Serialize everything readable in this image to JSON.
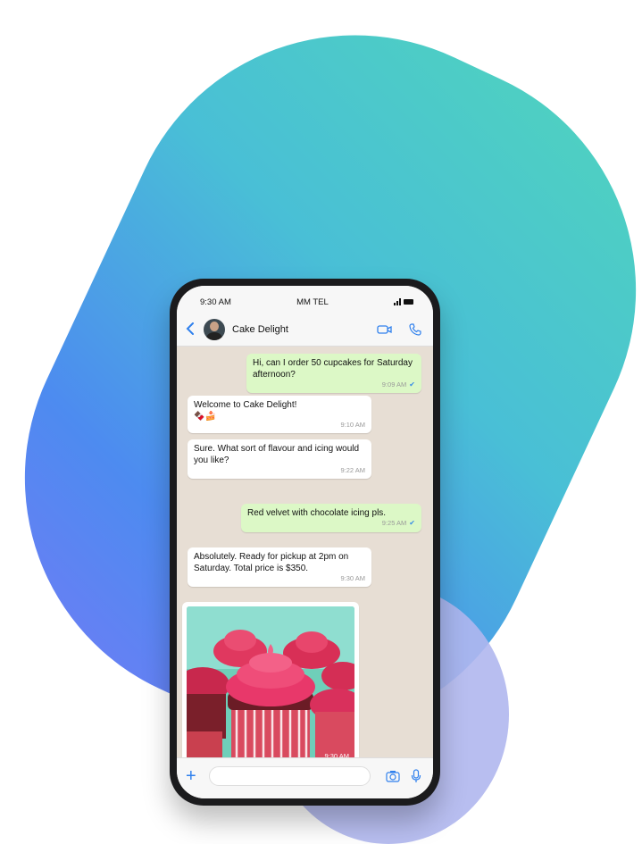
{
  "status": {
    "time": "9:30 AM",
    "carrier": "MM TEL"
  },
  "header": {
    "contact_name": "Cake Delight"
  },
  "messages": [
    {
      "direction": "out",
      "text": "Hi, can I order 50 cupcakes for Saturday afternoon?",
      "time": "9:09 AM"
    },
    {
      "direction": "in",
      "text": "Welcome to Cake Delight!",
      "emoji": "🍫🍰",
      "time": "9:10 AM"
    },
    {
      "direction": "in",
      "text": "Sure. What sort of flavour and icing would you like?",
      "time": "9:22 AM"
    },
    {
      "direction": "out",
      "text": "Red velvet with chocolate icing pls.",
      "time": "9:25 AM"
    },
    {
      "direction": "in",
      "text": "Absolutely. Ready for pickup at 2pm on Saturday. Total price is $350.",
      "time": "9:30 AM"
    }
  ],
  "photo_message": {
    "time": "9:30 AM",
    "subject": "red velvet cupcakes with pink frosting"
  },
  "composer": {
    "placeholder": ""
  },
  "colors": {
    "accent": "#2f80ed",
    "outgoing_bubble": "#dcf8c6",
    "incoming_bubble": "#ffffff",
    "chat_bg": "#e7ded4",
    "gradient_start": "#4fd3be",
    "gradient_end": "#6f7cf5"
  },
  "icons": [
    "back-arrow-icon",
    "avatar",
    "video-call-icon",
    "phone-call-icon",
    "read-tick-icon",
    "plus-icon",
    "camera-icon",
    "microphone-icon"
  ]
}
